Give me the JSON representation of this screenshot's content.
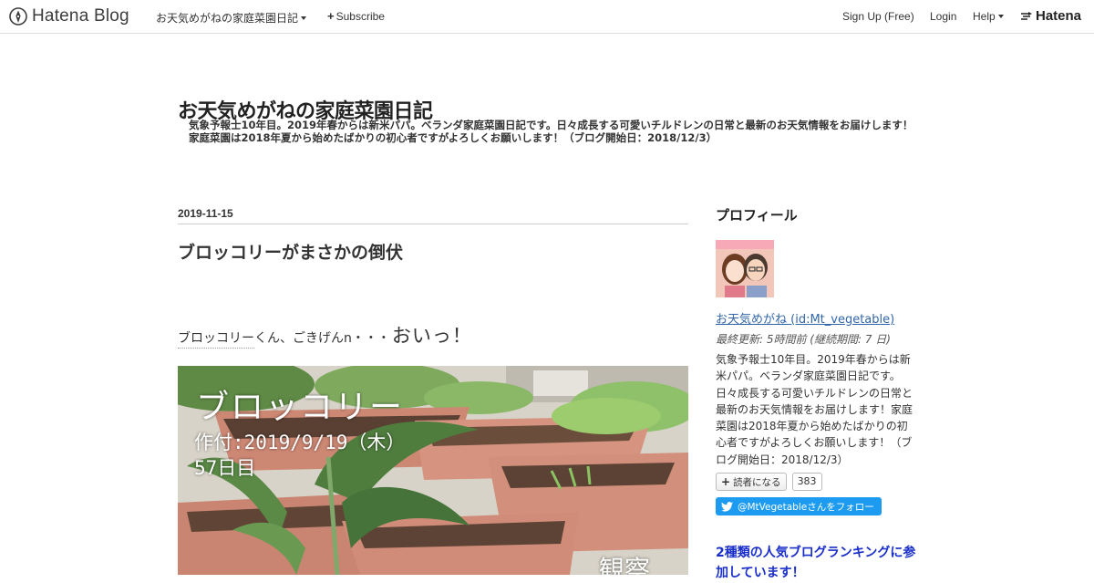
{
  "topbar": {
    "logo_text": "Hatena Blog",
    "blog_menu_label": "お天気めがねの家庭菜園日記",
    "subscribe_label": "Subscribe",
    "signup_label": "Sign Up (Free)",
    "login_label": "Login",
    "help_label": "Help",
    "hatena_label": "Hatena"
  },
  "blog": {
    "title": "お天気めがねの家庭菜園日記",
    "description": "気象予報士10年目。2019年春からは新米パパ。ベランダ家庭菜園日記です。日々成長する可愛いチルドレンの日常と最新のお天気情報をお届けします！家庭菜園は2018年夏から始めたばかりの初心者ですがよろしくお願いします！（ブログ開始日：2018/12/3）"
  },
  "entry": {
    "date": "2019-11-15",
    "title": "ブロッコリーがまさかの倒伏",
    "intro_link": "ブロッコリー",
    "intro_rest": "くん、ごきげんn・・・",
    "intro_big": "おいっ！",
    "photo_text": {
      "line1": "ブロッコリー",
      "line2": "作付:2019/9/19（木）",
      "line3": "57日目",
      "corner": "観察"
    }
  },
  "sidebar": {
    "profile_heading": "プロフィール",
    "profile_name": "お天気めがね (id:Mt_vegetable)",
    "last_updated": "最終更新: 5時間前 (継続期間: 7 日)",
    "description": "気象予報士10年目。2019年春からは新米パパ。ベランダ家庭菜園日記です。日々成長する可愛いチルドレンの日常と最新のお天気情報をお届けします！家庭菜園は2018年夏から始めたばかりの初心者ですがよろしくお願いします！（ブログ開始日：2018/12/3）",
    "reader_button_label": "読者になる",
    "reader_count": "383",
    "twitter_follow_label": "@MtVegetableさんをフォロー",
    "ranking_heading": "2種類の人気ブログランキングに参加しています！"
  },
  "colors": {
    "link_blue": "#3266a8",
    "ranking_blue": "#1a2ec9",
    "twitter_blue": "#1d9bf0",
    "border_gray": "#dddddd"
  },
  "icons": {
    "logo": "hatena-blog-pen-icon",
    "subscribe": "plus-icon",
    "dropdown": "caret-down-icon",
    "twitter": "twitter-bird-icon",
    "hatena": "hatena-mark-icon"
  }
}
